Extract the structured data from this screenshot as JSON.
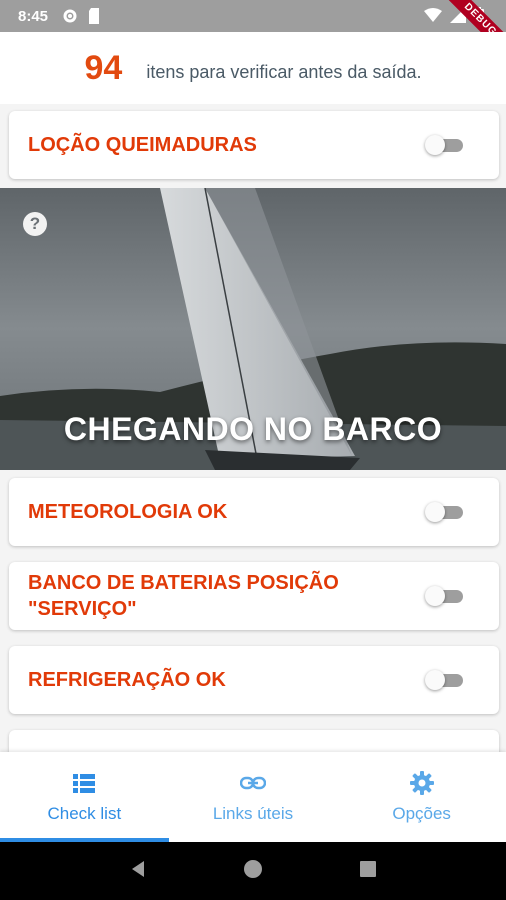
{
  "status_bar": {
    "time": "8:45",
    "debug_label": "DEBUG"
  },
  "summary": {
    "count": "94",
    "label": "itens para verificar antes da saída."
  },
  "checklist": [
    {
      "label": "LOÇÃO QUEIMADURAS",
      "checked": false
    },
    {
      "label": "METEOROLOGIA OK",
      "checked": false
    },
    {
      "label": "BANCO DE BATERIAS POSIÇÃO \"SERVIÇO\"",
      "checked": false
    },
    {
      "label": "REFRIGERAÇÃO OK",
      "checked": false
    }
  ],
  "section": {
    "title": "CHEGANDO NO BARCO",
    "help_icon": "question-circle-icon"
  },
  "bottom_nav": [
    {
      "label": "Check list",
      "icon": "list-icon",
      "active": true
    },
    {
      "label": "Links úteis",
      "icon": "link-icon",
      "active": false
    },
    {
      "label": "Opções",
      "icon": "gear-icon",
      "active": false
    }
  ],
  "colors": {
    "accent_orange": "#e13a08",
    "nav_blue": "#2f8de4",
    "status_gray": "#9e9e9e"
  }
}
